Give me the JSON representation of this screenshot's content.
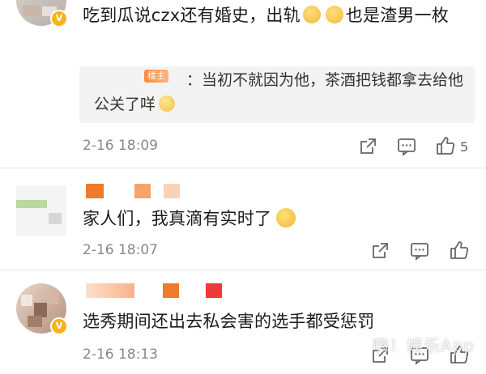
{
  "comments": [
    {
      "text": "吃到瓜说czx还有婚史，出轨",
      "text_suffix": "也是渣男一枚",
      "reply": {
        "tag": "楼主",
        "text": "：当初不就因为他，茶酒把钱都拿去给他公关了咩"
      },
      "time": "2-16 18:09",
      "likes": "5"
    },
    {
      "text": "家人们，我真滴有实时了",
      "time": "2-16 18:07",
      "likes": ""
    },
    {
      "text": "选秀期间还出去私会害的选手都受惩罚",
      "time": "2-16 18:13",
      "likes": ""
    }
  ],
  "badge": {
    "verified": "V"
  },
  "watermark": "嗨！娱乐App",
  "colors": {
    "verified_badge": "#f5b51a",
    "reply_bg": "#f3f3f3",
    "meta_text": "#888888",
    "divider": "#e6e6e6"
  },
  "icons": [
    "share-icon",
    "comment-icon",
    "like-icon"
  ]
}
